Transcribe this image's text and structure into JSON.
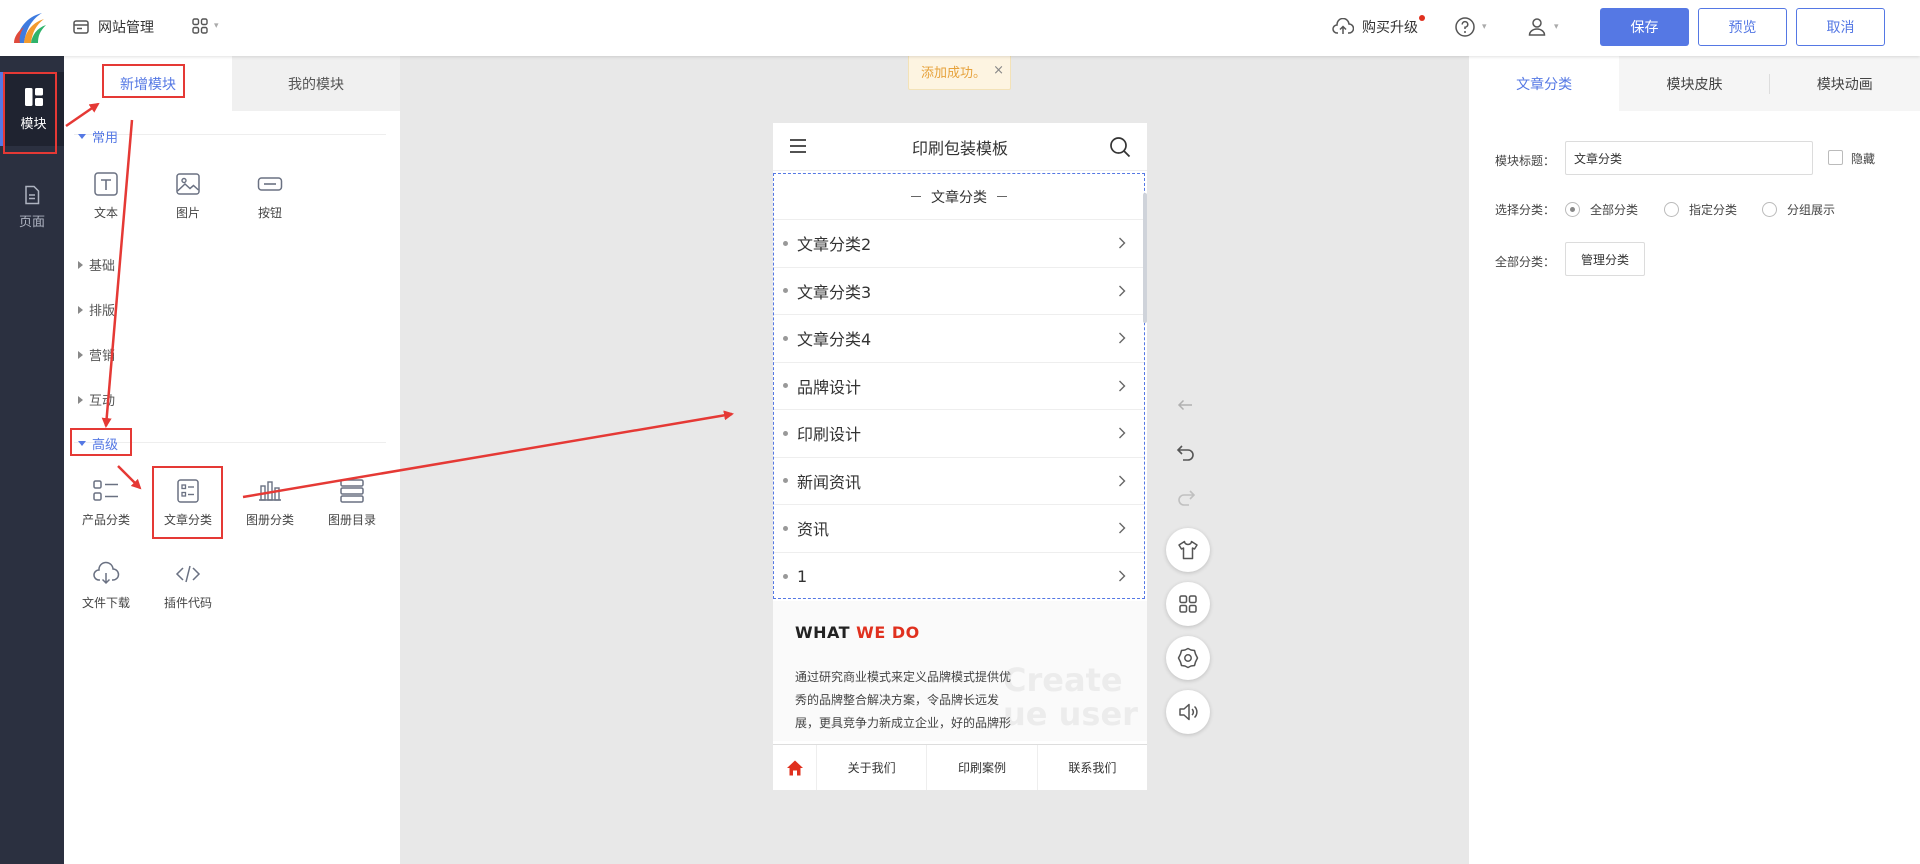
{
  "topbar": {
    "site_manage": "网站管理",
    "buy_upgrade": "购买升级",
    "save": "保存",
    "preview": "预览",
    "cancel": "取消"
  },
  "leftnav": {
    "module": "模块",
    "page": "页面"
  },
  "module_panel": {
    "tab_new": "新增模块",
    "tab_mine": "我的模块",
    "group_common": "常用",
    "common_items": [
      "文本",
      "图片",
      "按钮"
    ],
    "group_basic": "基础",
    "group_layout": "排版",
    "group_marketing": "营销",
    "group_interact": "互动",
    "group_advanced": "高级",
    "advanced_items": [
      "产品分类",
      "文章分类",
      "图册分类",
      "图册目录",
      "文件下载",
      "插件代码"
    ]
  },
  "toast": {
    "text": "添加成功。",
    "close": "×"
  },
  "phone": {
    "title": "印刷包装模板",
    "module_title": "文章分类",
    "rows": [
      "文章分类2",
      "文章分类3",
      "文章分类4",
      "品牌设计",
      "印刷设计",
      "新闻资讯",
      "资讯",
      "1"
    ],
    "what_prefix": "WHAT ",
    "what_highlight": "WE DO",
    "what_bg": "Create\nue user",
    "what_text": "通过研究商业模式来定义品牌模式提供优秀的品牌整合解决方案，令品牌长远发展，更具竞争力新成立企业，好的品牌形",
    "footer": [
      "关于我们",
      "印刷案例",
      "联系我们"
    ]
  },
  "right_panel": {
    "tabs": [
      "文章分类",
      "模块皮肤",
      "模块动画"
    ],
    "title_label": "模块标题：",
    "title_value": "文章分类",
    "hide_label": "隐藏",
    "select_label": "选择分类：",
    "options": [
      "全部分类",
      "指定分类",
      "分组展示"
    ],
    "all_label": "全部分类：",
    "manage_btn": "管理分类"
  },
  "colors": {
    "accent": "#5578e4",
    "nav_bg": "#2b3040",
    "annotation": "#e53935",
    "what_red": "#e0301e"
  }
}
